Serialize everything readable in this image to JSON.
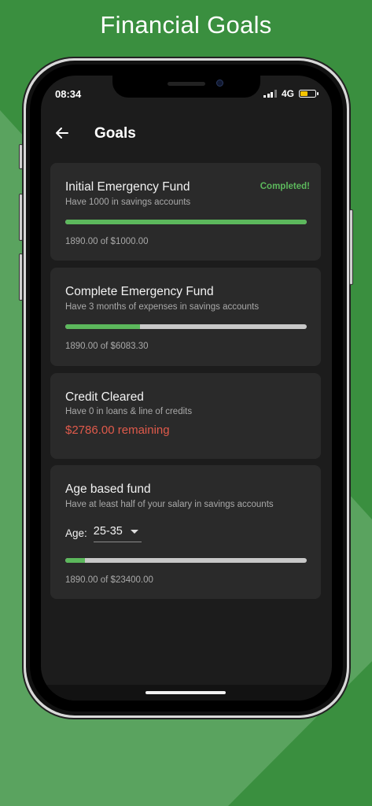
{
  "hero": {
    "title": "Financial Goals"
  },
  "status_bar": {
    "time": "08:34",
    "network": "4G",
    "signal_icon": "signal-icon",
    "battery_icon": "battery-icon",
    "battery_level": 0.5
  },
  "app_bar": {
    "title": "Goals",
    "back_icon": "arrow-left-icon"
  },
  "colors": {
    "background": "#3a8f3f",
    "card": "#2a2a2a",
    "screen": "#1c1c1c",
    "progress": "#5cb85c",
    "track": "#c8c8c8",
    "warning": "#e05a4b"
  },
  "goals": [
    {
      "title": "Initial Emergency Fund",
      "subtitle": "Have 1000 in savings accounts",
      "status": "Completed!",
      "progress": 1.0,
      "progress_text": "1890.00 of $1000.00"
    },
    {
      "title": "Complete Emergency Fund",
      "subtitle": "Have 3 months of expenses in savings accounts",
      "progress": 0.31,
      "progress_text": "1890.00 of $6083.30"
    },
    {
      "title": "Credit Cleared",
      "subtitle": "Have 0 in loans & line of credits",
      "remaining": "$2786.00 remaining"
    },
    {
      "title": "Age based fund",
      "subtitle": "Have at least half of your salary in savings accounts",
      "age_label": "Age:",
      "age_value": "25-35",
      "progress": 0.08,
      "progress_text": "1890.00 of $23400.00"
    }
  ]
}
